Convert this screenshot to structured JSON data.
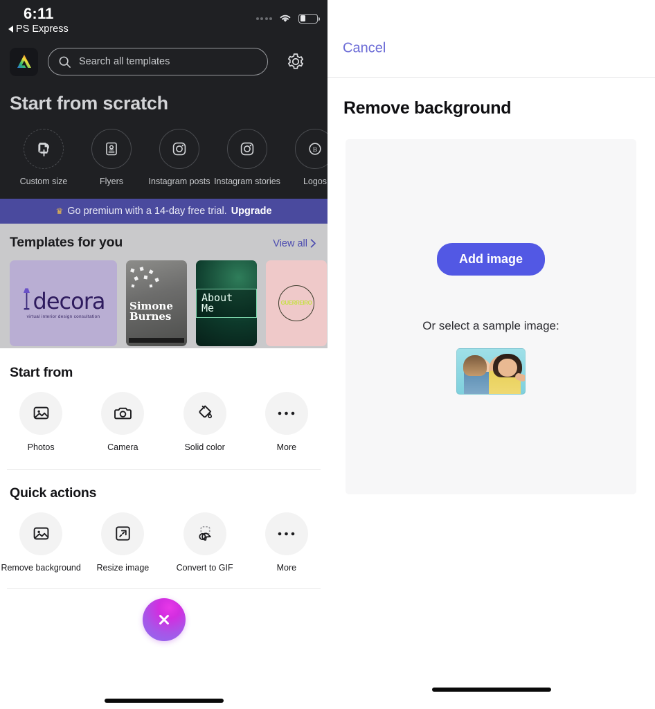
{
  "status_bar": {
    "time": "6:11",
    "back_app": "PS Express",
    "signal_icon": "signal-dots-icon",
    "wifi_icon": "wifi-icon",
    "battery_icon": "battery-low-icon"
  },
  "header": {
    "logo_icon": "adobe-express-logo-icon",
    "search_placeholder": "Search all templates",
    "search_value": "",
    "search_icon": "search-icon",
    "settings_icon": "gear-icon"
  },
  "start_from_scratch": {
    "title": "Start from scratch",
    "items": [
      {
        "label": "Custom size",
        "icon": "file-plus-icon"
      },
      {
        "label": "Flyers",
        "icon": "flyer-portrait-icon"
      },
      {
        "label": "Instagram posts",
        "icon": "instagram-camera-icon"
      },
      {
        "label": "Instagram stories",
        "icon": "instagram-camera-icon"
      },
      {
        "label": "Logos",
        "icon": "logo-b-badge-icon"
      }
    ]
  },
  "premium_banner": {
    "crown_icon": "crown-icon",
    "text": "Go premium with a 14-day free trial.",
    "cta": "Upgrade",
    "background": "#4a4a9e"
  },
  "templates": {
    "title": "Templates for you",
    "view_all": "View all",
    "chevron_icon": "chevron-right-icon",
    "cards": [
      {
        "name": "decora",
        "tagline": "virtual interior design consultation",
        "color": "#b9aed3"
      },
      {
        "name": "Simone Burnes",
        "tagline": "",
        "color": "#6d6d6c"
      },
      {
        "name": "About Me",
        "tagline": "",
        "color": "#0d3a2b"
      },
      {
        "name": "GUERREIRO",
        "tagline": "",
        "color": "#efc9c9"
      }
    ]
  },
  "start_from": {
    "title": "Start from",
    "items": [
      {
        "label": "Photos",
        "icon": "image-icon"
      },
      {
        "label": "Camera",
        "icon": "camera-icon"
      },
      {
        "label": "Solid color",
        "icon": "paint-bucket-icon"
      },
      {
        "label": "More",
        "icon": "more-dots-icon"
      }
    ]
  },
  "quick_actions": {
    "title": "Quick actions",
    "items": [
      {
        "label": "Remove background",
        "icon": "image-icon"
      },
      {
        "label": "Resize image",
        "icon": "resize-arrow-icon"
      },
      {
        "label": "Convert to GIF",
        "icon": "convert-gif-icon"
      },
      {
        "label": "More",
        "icon": "more-dots-icon"
      }
    ]
  },
  "fab": {
    "icon": "close-x-icon",
    "gradient_start": "#e838e8",
    "gradient_end": "#8b6ef0"
  },
  "right_panel": {
    "cancel_label": "Cancel",
    "cancel_color": "#6b6bd6",
    "title": "Remove background",
    "add_image_label": "Add image",
    "add_image_color": "#5258e4",
    "or_text": "Or select a sample image:",
    "sample_image_name": "sample-photo-two-women"
  }
}
